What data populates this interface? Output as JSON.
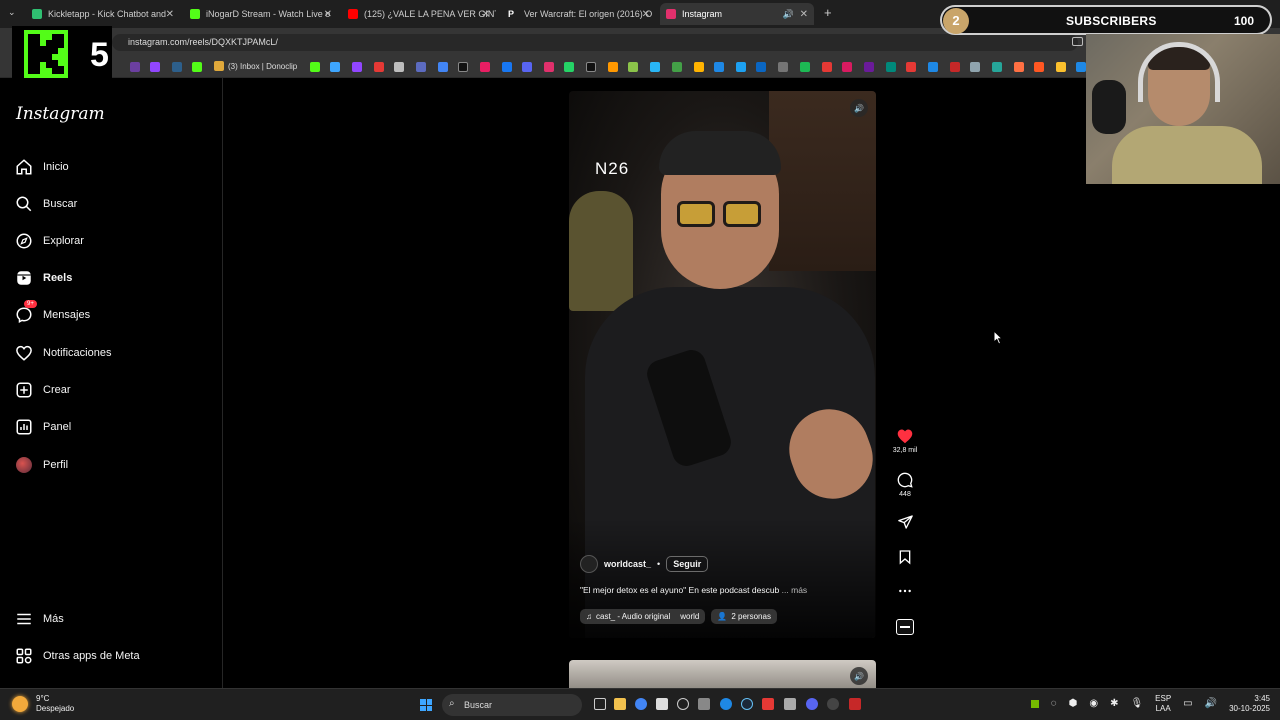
{
  "browser": {
    "tabs": [
      {
        "title": "Kickletapp - Kick Chatbot and",
        "color": "#2fbf71"
      },
      {
        "title": "iNogarD Stream - Watch Live o",
        "color": "#53fc18"
      },
      {
        "title": "(125) ¿VALE LA PENA VER GINT",
        "color": "#ff0000"
      },
      {
        "title": "Ver Warcraft: El origen (2016) O",
        "color": "#ffffff"
      },
      {
        "title": "Instagram",
        "color": "#e1306c"
      }
    ],
    "url": "instagram.com/reels/DQXKTJPAMcL/",
    "bookmark_inbox": "(3) Inbox | Donoclip"
  },
  "overlay": {
    "k5_number": "5",
    "subscribers": {
      "current": "2",
      "label": "SUBSCRIBERS",
      "goal": "100",
      "fill_fraction": 0.02
    }
  },
  "sidebar": {
    "logo": "Instagram",
    "items": [
      {
        "label": "Inicio",
        "icon": "home-icon"
      },
      {
        "label": "Buscar",
        "icon": "search-icon"
      },
      {
        "label": "Explorar",
        "icon": "compass-icon"
      },
      {
        "label": "Reels",
        "icon": "reels-icon"
      },
      {
        "label": "Mensajes",
        "icon": "messenger-icon",
        "badge": "9+"
      },
      {
        "label": "Notificaciones",
        "icon": "heart-icon"
      },
      {
        "label": "Crear",
        "icon": "plus-square-icon"
      },
      {
        "label": "Panel",
        "icon": "chart-icon"
      },
      {
        "label": "Perfil",
        "icon": "avatar"
      }
    ],
    "bottom": [
      {
        "label": "Más",
        "icon": "menu-icon"
      },
      {
        "label": "Otras apps de Meta",
        "icon": "meta-apps-icon"
      }
    ]
  },
  "reel": {
    "watermark": "N26",
    "author": "worldcast_",
    "follow": "Seguir",
    "caption": "\"El mejor detox es el ayuno\" En este podcast descub",
    "more": "... más",
    "audio": "cast_ - Audio original",
    "audio_tag": "world",
    "people": "2 personas",
    "likes": "32,8 mil",
    "comments": "448"
  },
  "taskbar": {
    "temp": "9°C",
    "weather": "Despejado",
    "search": "Buscar",
    "lang_top": "ESP",
    "lang_bottom": "LAA",
    "time": "3:45",
    "date": "30-10-2025"
  }
}
